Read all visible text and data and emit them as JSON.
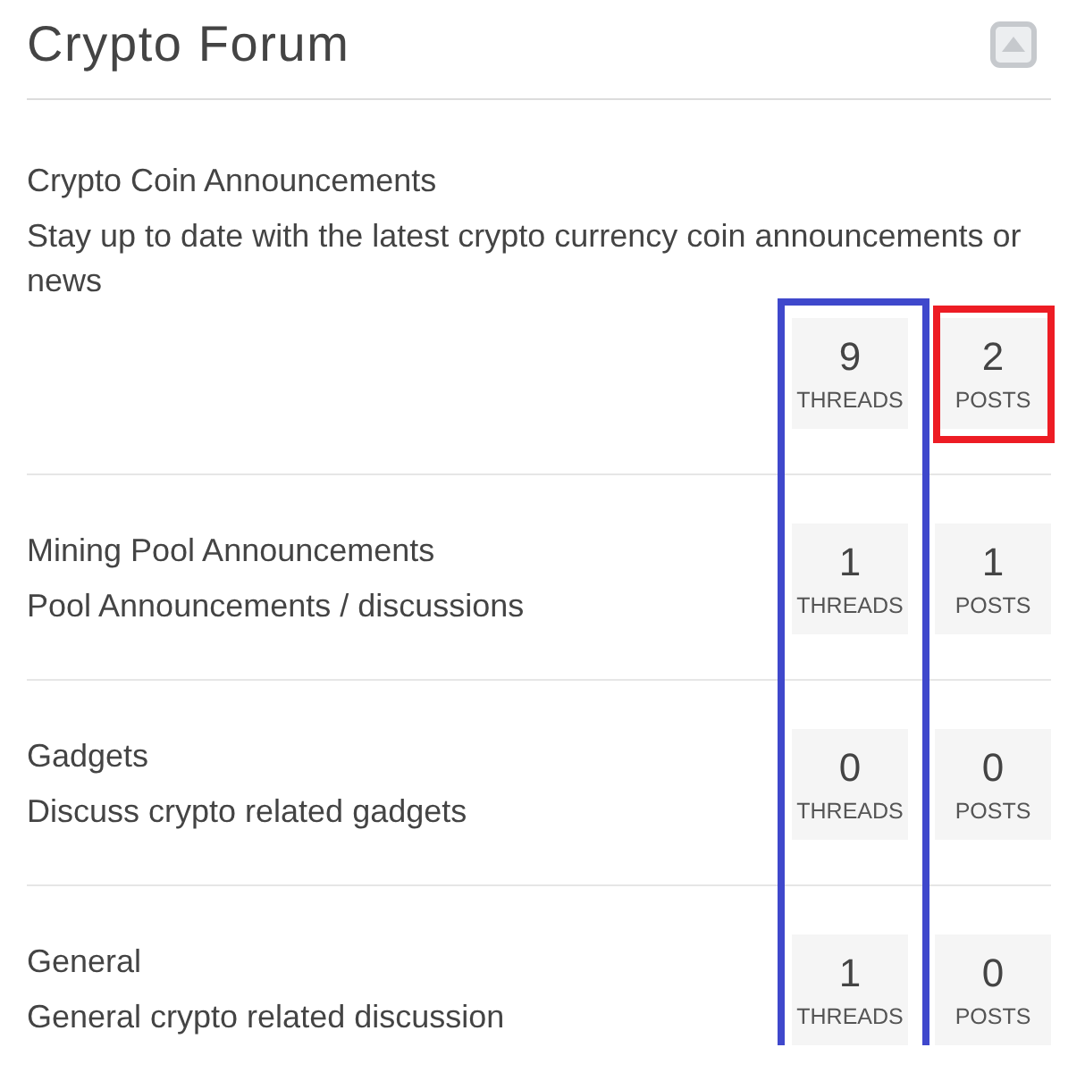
{
  "panel": {
    "title": "Crypto Forum"
  },
  "forums": [
    {
      "title": "Crypto Coin Announcements",
      "description": "Stay up to date with the latest crypto currency coin announcements or news",
      "stats": [
        {
          "count": "9",
          "label": "THREADS"
        },
        {
          "count": "2",
          "label": "POSTS"
        }
      ]
    },
    {
      "title": "Mining Pool Announcements",
      "description": "Pool Announcements / discussions",
      "stats": [
        {
          "count": "1",
          "label": "THREADS"
        },
        {
          "count": "1",
          "label": "POSTS"
        }
      ]
    },
    {
      "title": "Gadgets",
      "description": "Discuss crypto related gadgets",
      "stats": [
        {
          "count": "0",
          "label": "THREADS"
        },
        {
          "count": "0",
          "label": "POSTS"
        }
      ]
    },
    {
      "title": "General",
      "description": "General crypto related discussion",
      "stats": [
        {
          "count": "1",
          "label": "THREADS"
        },
        {
          "count": "0",
          "label": "POSTS"
        }
      ]
    }
  ],
  "highlights": [
    {
      "kind": "column",
      "color": "#3f48cc"
    },
    {
      "kind": "cell",
      "color": "#ed1c24"
    }
  ]
}
